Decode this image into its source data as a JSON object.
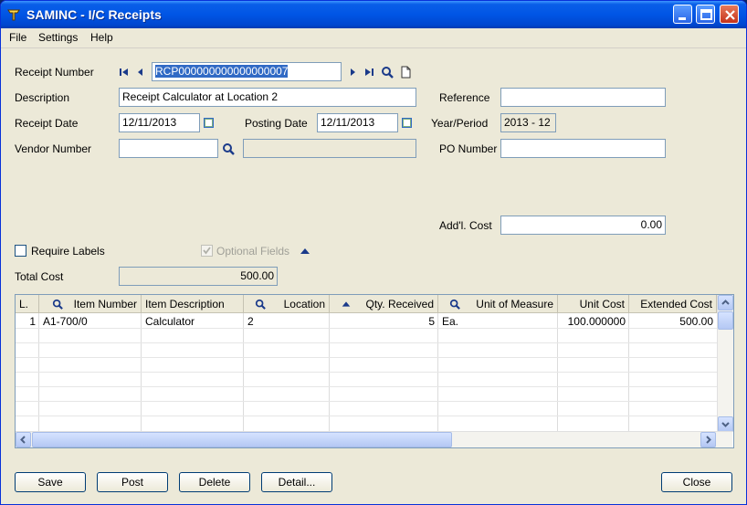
{
  "window": {
    "title": "SAMINC - I/C Receipts"
  },
  "menu": {
    "file": "File",
    "settings": "Settings",
    "help": "Help"
  },
  "form": {
    "receipt_number_label": "Receipt Number",
    "receipt_number_value": "RCP000000000000000007",
    "description_label": "Description",
    "description_value": "Receipt Calculator at Location 2",
    "reference_label": "Reference",
    "reference_value": "",
    "receipt_date_label": "Receipt Date",
    "receipt_date_value": "12/11/2013",
    "posting_date_label": "Posting Date",
    "posting_date_value": "12/11/2013",
    "year_period_label": "Year/Period",
    "year_period_value": "2013 - 12",
    "vendor_number_label": "Vendor Number",
    "vendor_number_value": "",
    "vendor_name_value": "",
    "po_number_label": "PO Number",
    "po_number_value": "",
    "addl_cost_label": "Add'l. Cost",
    "addl_cost_value": "0.00",
    "require_labels_label": "Require Labels",
    "optional_fields_label": "Optional Fields",
    "total_cost_label": "Total Cost",
    "total_cost_value": "500.00"
  },
  "grid": {
    "headers": [
      "L.",
      "Item Number",
      "Item Description",
      "Location",
      "Qty. Received",
      "Unit of Measure",
      "Unit Cost",
      "Extended Cost"
    ],
    "rows": [
      {
        "line": "1",
        "item_number": "A1-700/0",
        "item_description": "Calculator",
        "location": "2",
        "qty_received": "5",
        "uom": "Ea.",
        "unit_cost": "100.000000",
        "extended_cost": "500.00"
      }
    ]
  },
  "buttons": {
    "save": "Save",
    "post": "Post",
    "delete": "Delete",
    "detail": "Detail...",
    "close": "Close"
  },
  "colors": {
    "titlebar": "#0055e5",
    "selection": "#316ac5",
    "window_bg": "#ece9d8"
  }
}
